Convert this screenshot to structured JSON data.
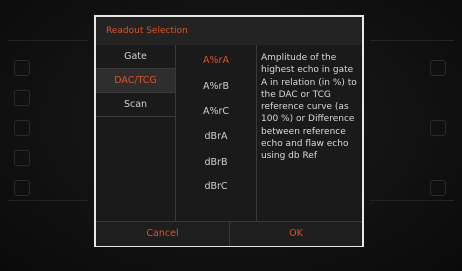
{
  "dialog": {
    "title": "Readout Selection",
    "categories": [
      {
        "label": "Gate",
        "selected": false
      },
      {
        "label": "DAC/TCG",
        "selected": true
      },
      {
        "label": "Scan",
        "selected": false
      }
    ],
    "readouts": [
      {
        "label": "A%rA",
        "selected": true
      },
      {
        "label": "A%rB",
        "selected": false
      },
      {
        "label": "A%rC",
        "selected": false
      },
      {
        "label": "dBrA",
        "selected": false
      },
      {
        "label": "dBrB",
        "selected": false
      },
      {
        "label": "dBrC",
        "selected": false
      }
    ],
    "description": "Amplitude of the highest echo in gate A in relation (in %) to the DAC or TCG reference curve (as 100 %) or Difference between reference echo and flaw echo using db Ref",
    "cancel_label": "Cancel",
    "ok_label": "OK"
  },
  "colors": {
    "accent": "#d9542a",
    "text": "#cfcfcf",
    "border": "#e8e8e8",
    "background": "#000000"
  }
}
